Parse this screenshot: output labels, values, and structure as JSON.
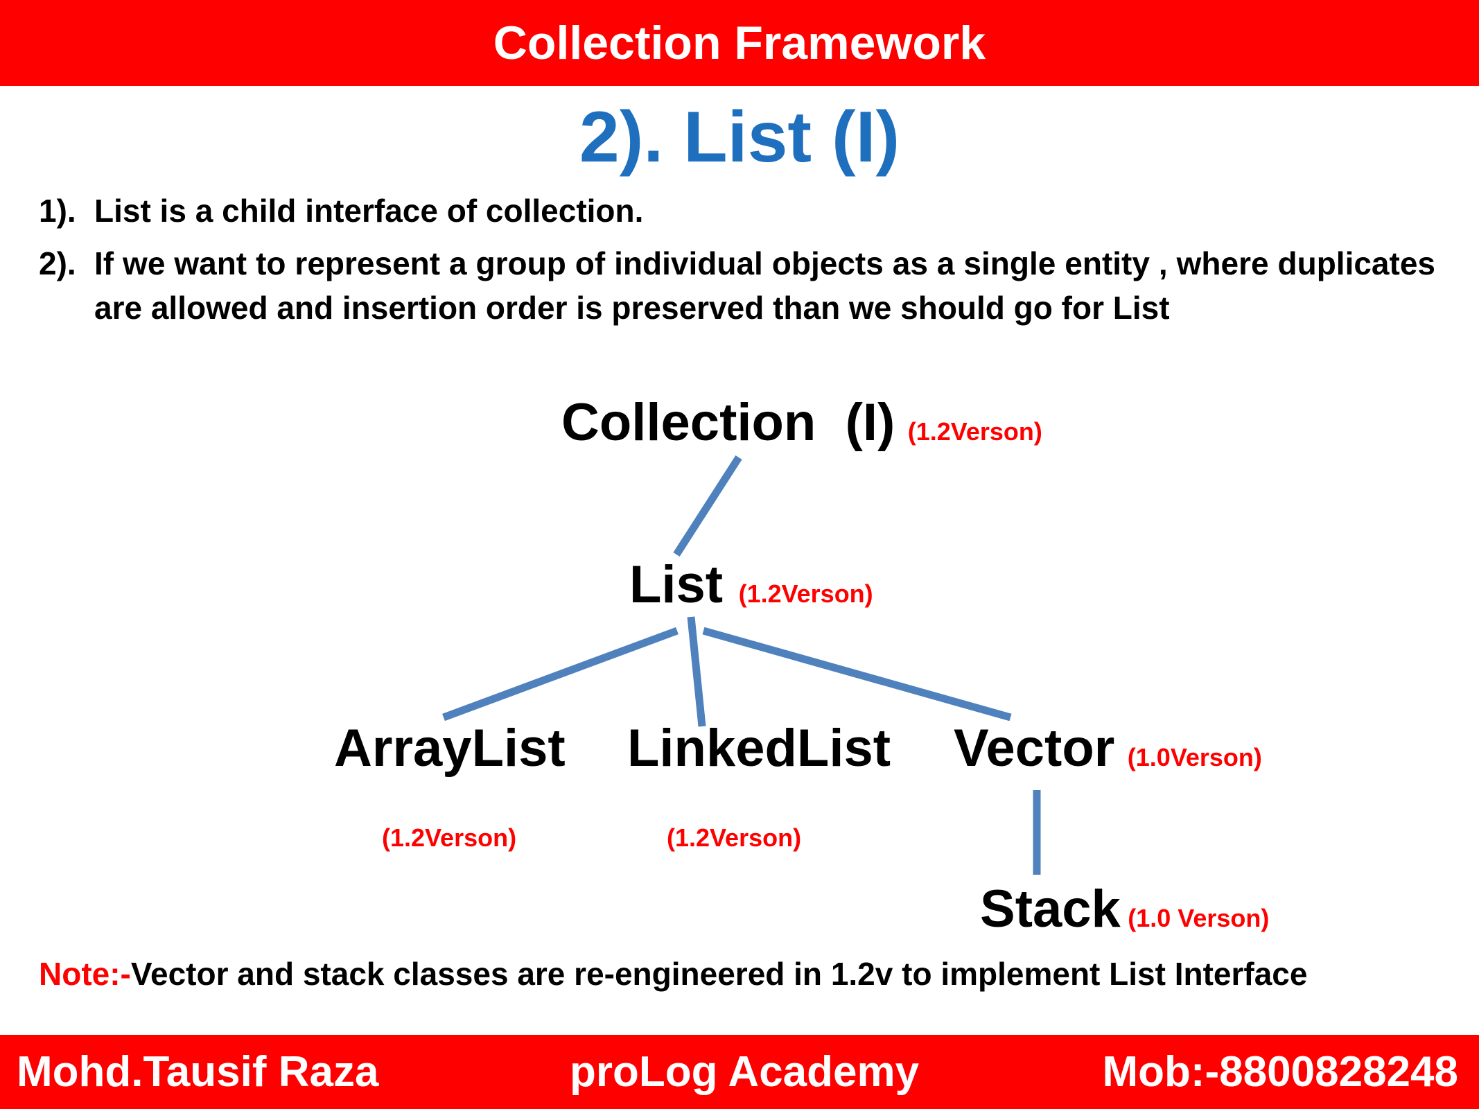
{
  "header": {
    "title": "Collection Framework"
  },
  "subtitle": "2). List (I)",
  "points": [
    {
      "num": "1).",
      "text": "List is a child interface of collection."
    },
    {
      "num": "2).",
      "text": "If we want to represent a group of individual objects as a single entity , where duplicates are allowed and insertion order is preserved than we should go for List"
    }
  ],
  "diagram": {
    "collection": {
      "name": "Collection  (I)",
      "version": "(1.2Verson)"
    },
    "list": {
      "name": "List",
      "version": "(1.2Verson)"
    },
    "arraylist": {
      "name": "ArrayList",
      "version": "(1.2Verson)"
    },
    "linkedlist": {
      "name": "LinkedList",
      "version": "(1.2Verson)"
    },
    "vector": {
      "name": "Vector",
      "version": "(1.0Verson)"
    },
    "stack": {
      "name": "Stack",
      "version": "(1.0 Verson)"
    },
    "line_color": "#4f81bd",
    "version_color": "#ff0000"
  },
  "note": {
    "label": "Note:-",
    "text": "Vector and stack classes are re-engineered in 1.2v to implement List Interface"
  },
  "footer": {
    "author": "Mohd.Tausif Raza",
    "academy": "proLog Academy",
    "mobile": "Mob:-8800828248"
  }
}
